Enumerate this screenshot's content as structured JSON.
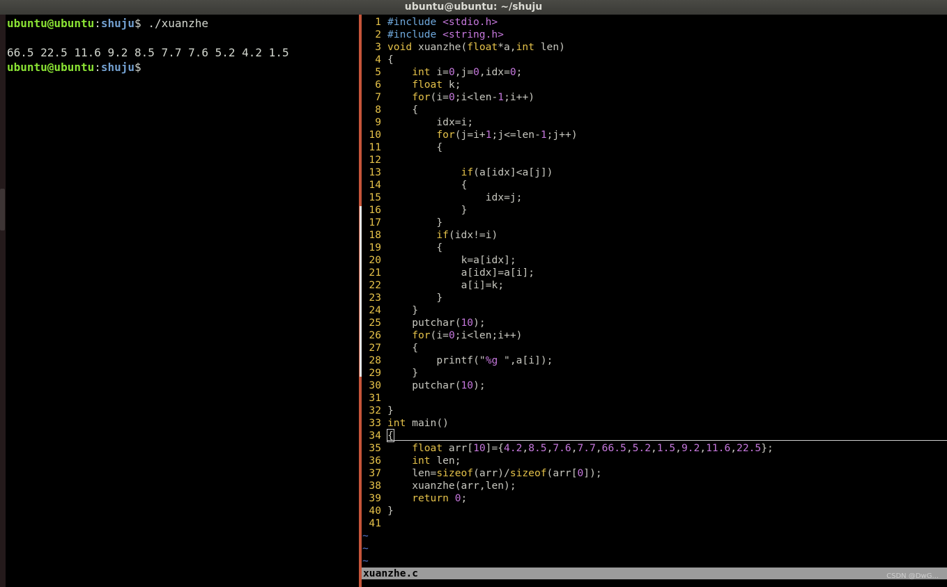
{
  "window": {
    "title": "ubuntu@ubuntu: ~/shuju"
  },
  "left_terminal": {
    "prompt_user": "ubuntu@ubuntu",
    "prompt_sep": ":",
    "prompt_path": "shuju",
    "prompt_symbol": "$",
    "command": " ./xuanzhe",
    "output": "66.5 22.5 11.6 9.2 8.5 7.7 7.6 5.2 4.2 1.5"
  },
  "vim": {
    "filename": "xuanzhe.c",
    "tildes": [
      "~",
      "~",
      "~"
    ]
  },
  "watermark": "CSDN @DwG..."
}
